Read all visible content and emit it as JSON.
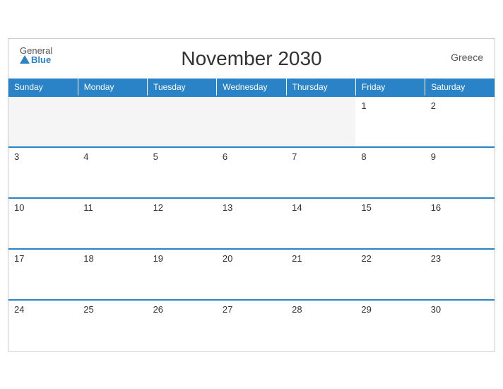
{
  "header": {
    "title": "November 2030",
    "country": "Greece",
    "logo_general": "General",
    "logo_blue": "Blue"
  },
  "weekdays": [
    "Sunday",
    "Monday",
    "Tuesday",
    "Wednesday",
    "Thursday",
    "Friday",
    "Saturday"
  ],
  "weeks": [
    [
      null,
      null,
      null,
      null,
      null,
      1,
      2
    ],
    [
      3,
      4,
      5,
      6,
      7,
      8,
      9
    ],
    [
      10,
      11,
      12,
      13,
      14,
      15,
      16
    ],
    [
      17,
      18,
      19,
      20,
      21,
      22,
      23
    ],
    [
      24,
      25,
      26,
      27,
      28,
      29,
      30
    ]
  ]
}
